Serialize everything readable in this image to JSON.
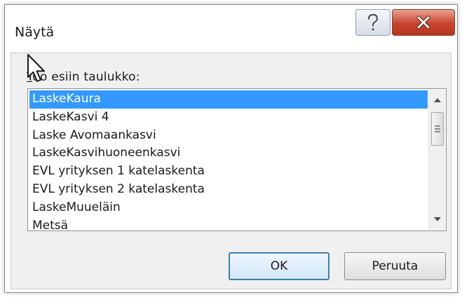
{
  "dialog": {
    "title": "Näytä",
    "help_icon": "question-mark-icon",
    "close_icon": "close-x-icon"
  },
  "list": {
    "label_underlined": "T",
    "label_rest": "uo esiin taulukko:",
    "items": [
      "LaskeKaura",
      "LaskeKasvi 4",
      "Laske Avomaankasvi",
      "LaskeKasvihuoneenkasvi",
      "EVL yrityksen 1 katelaskenta",
      "EVL yrityksen 2 katelaskenta",
      "LaskeMuueläin",
      "Metsä"
    ],
    "selected_index": 0
  },
  "buttons": {
    "ok_label": "OK",
    "cancel_label": "Peruuta"
  },
  "colors": {
    "selection": "#3399ff",
    "close_button": "#c8442f",
    "default_button_border": "#3c7fb1"
  }
}
